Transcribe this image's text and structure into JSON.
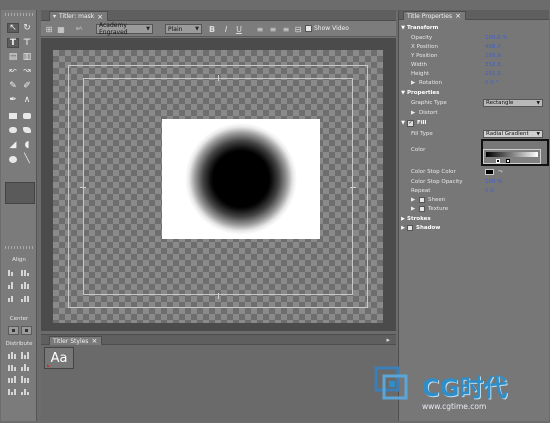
{
  "tools": {
    "align_label": "Align",
    "center_label": "Center",
    "distribute_label": "Distribute"
  },
  "titler": {
    "tab_label": "Titler: mask",
    "font_family": "Academy Engraved",
    "font_style": "Plain",
    "show_video_label": "Show Video",
    "show_video_checked": false
  },
  "styles_panel": {
    "tab_label": "Titler Styles",
    "thumb_text": "Aa"
  },
  "properties": {
    "tab_label": "Title Properties",
    "transform_label": "Transform",
    "opacity_label": "Opacity",
    "opacity_value": "100.0 %",
    "xpos_label": "X Position",
    "xpos_value": "408.7",
    "ypos_label": "Y Position",
    "ypos_value": "255.9",
    "width_label": "Width",
    "width_value": "352.3",
    "height_label": "Height",
    "height_value": "251.3",
    "rotation_label": "Rotation",
    "rotation_value": "0.0 °",
    "properties_label": "Properties",
    "graphic_type_label": "Graphic Type",
    "graphic_type_value": "Rectangle",
    "distort_label": "Distort",
    "fill_label": "Fill",
    "fill_type_label": "Fill Type",
    "fill_type_value": "Radial Gradient",
    "color_label": "Color",
    "color_stop_color_label": "Color Stop Color",
    "color_stop_opacity_label": "Color Stop Opacity",
    "color_stop_opacity_value": "100 %",
    "repeat_label": "Repeat",
    "repeat_value": "0.0",
    "sheen_label": "Sheen",
    "texture_label": "Texture",
    "strokes_label": "Strokes",
    "shadow_label": "Shadow"
  },
  "watermark": {
    "brand": "CG时代",
    "url": "www.cgtime.com"
  },
  "colors": {
    "value_blue": "#3d5fd6",
    "panel_gray": "#777777",
    "stage_dark": "#4b4b4b"
  }
}
